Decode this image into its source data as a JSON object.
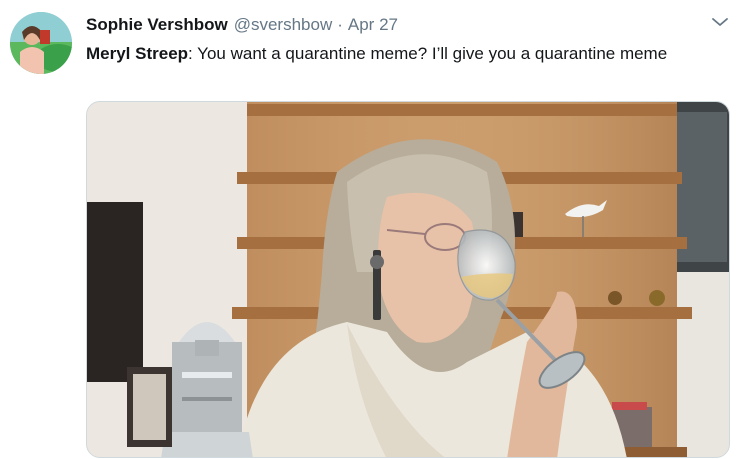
{
  "tweet": {
    "display_name": "Sophie Vershbow",
    "handle": "@svershbow",
    "separator": "·",
    "date": "Apr 27",
    "text_author": "Meryl Streep",
    "text_body": ": You want a quarantine meme? I’ll give you a quarantine meme"
  },
  "icons": {
    "caret": "chevron-down-icon"
  }
}
